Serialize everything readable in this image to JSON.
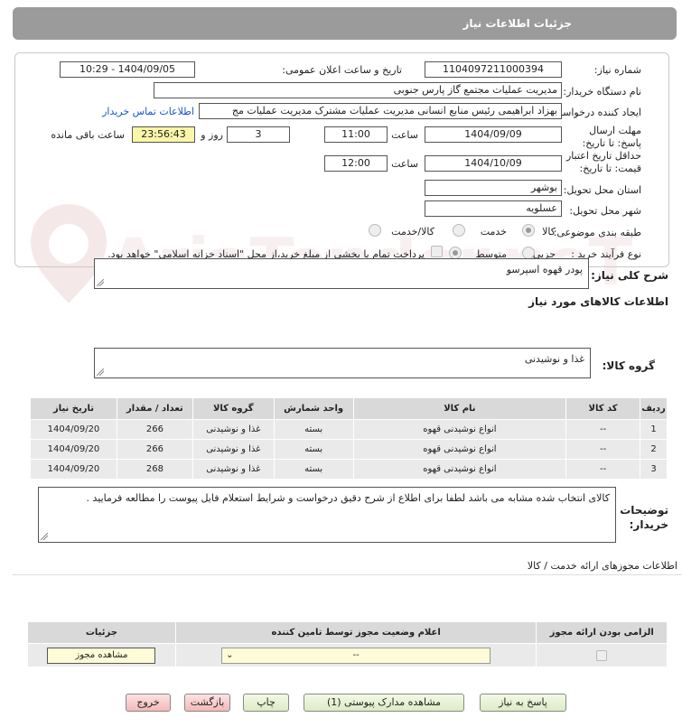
{
  "header": {
    "title": "جزئیات اطلاعات نیاز"
  },
  "form": {
    "need_number_label": "شماره نیاز:",
    "need_number": "1104097211000394",
    "announce_label": "تاریخ و ساعت اعلان عمومی:",
    "announce_value": "1404/09/05 - 10:29",
    "buyer_label": "نام دستگاه خریدار:",
    "buyer_value": "مدیریت عملیات مجتمع گاز پارس جنوبی",
    "creator_label": "ایجاد کننده درخواست:",
    "creator_value": "بهزاد ابراهیمی رئیس منابع انسانی مدیریت عملیات مشترک  مدیریت عملیات مج",
    "contact_link": "اطلاعات تماس خریدار",
    "deadline_label": "مهلت ارسال پاسخ: تا تاریخ:",
    "deadline_date": "1404/09/09",
    "time_label": "ساعت",
    "deadline_time": "11:00",
    "days_value": "3",
    "days_label": "روز و",
    "remaining_time": "23:56:43",
    "remaining_label": "ساعت باقی مانده",
    "validity_label": "حداقل تاریخ اعتبار قیمت: تا تاریخ:",
    "validity_date": "1404/10/09",
    "validity_time_label": "ساعت",
    "validity_time": "12:00",
    "province_label": "استان محل تحویل:",
    "province_value": "بوشهر",
    "city_label": "شهر محل تحویل:",
    "city_value": "عسلویه",
    "category_label": "طبقه بندی موضوعی:",
    "category_options": [
      "کالا",
      "خدمت",
      "کالا/خدمت"
    ],
    "process_label": "نوع فرآیند خرید :",
    "process_options": [
      "جزیی",
      "متوسط"
    ],
    "payment_note": "پرداخت تمام یا بخشی از مبلغ خرید،از محل \"اسناد خزانه اسلامی\" خواهد بود."
  },
  "summary": {
    "label": "شرح کلی نیاز:",
    "value": "پودر قهوه اسپرسو"
  },
  "goods": {
    "section_title": "اطلاعات کالاهای مورد نیاز",
    "group_label": "گروه کالا:",
    "group_value": "غذا و نوشیدنی",
    "columns": [
      "ردیف",
      "کد کالا",
      "نام کالا",
      "واحد شمارش",
      "گروه کالا",
      "تعداد / مقدار",
      "تاریخ نیاز"
    ],
    "rows": [
      [
        "1",
        "--",
        "انواع نوشیدنی قهوه",
        "بسته",
        "غذا و نوشیدنی",
        "266",
        "1404/09/20"
      ],
      [
        "2",
        "--",
        "انواع نوشیدنی قهوه",
        "بسته",
        "غذا و نوشیدنی",
        "266",
        "1404/09/20"
      ],
      [
        "3",
        "--",
        "انواع نوشیدنی قهوه",
        "بسته",
        "غذا و نوشیدنی",
        "268",
        "1404/09/20"
      ]
    ]
  },
  "buyer_notes": {
    "label": "توضیحات خریدار:",
    "value": "کالای انتخاب شده مشابه می باشد لطفا برای اطلاع از شرح دقیق درخواست و شرایط استعلام فایل پیوست را مطالعه فرمایید ."
  },
  "permits": {
    "section_title": "اطلاعات مجوزهای ارائه خدمت / کالا",
    "columns": [
      "الزامی بودن ارائه مجوز",
      "اعلام وضعیت مجوز توسط تامین کننده",
      "جزئیات"
    ],
    "select_value": "--",
    "view_button": "مشاهده مجوز"
  },
  "buttons": {
    "reply": "پاسخ به نیاز",
    "attachments": "مشاهده مدارک پیوستی (1)",
    "print": "چاپ",
    "back": "بازگشت",
    "exit": "خروج"
  },
  "watermark": "AriaTender.neT",
  "colors": {
    "header": "#9b9b9b",
    "timer": "#f9f6a8",
    "link": "#1a55c8",
    "button": "#dcebc3",
    "danger_button": "#f5b8b8"
  }
}
